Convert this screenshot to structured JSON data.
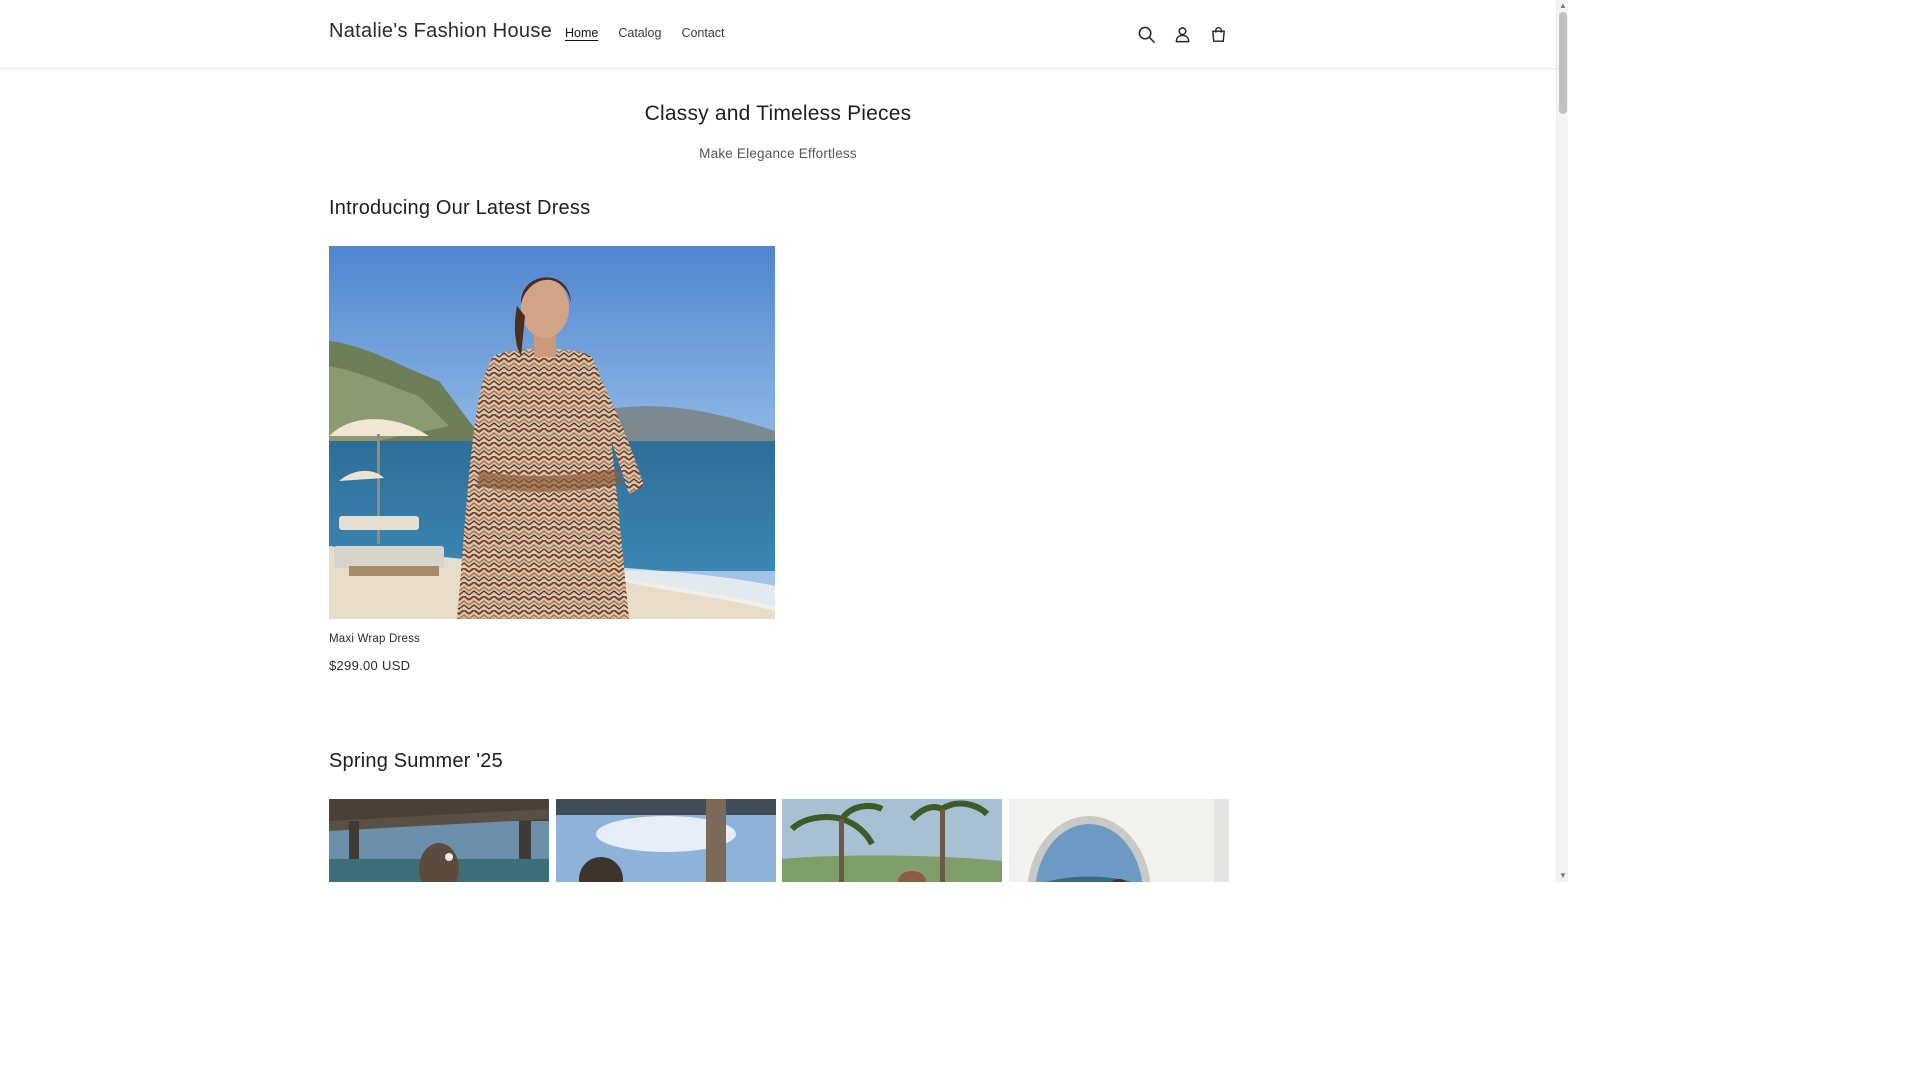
{
  "header": {
    "brand": "Natalie's Fashion House",
    "nav": [
      {
        "label": "Home",
        "active": true
      },
      {
        "label": "Catalog",
        "active": false
      },
      {
        "label": "Contact",
        "active": false
      }
    ],
    "icons": [
      "search-icon",
      "account-icon",
      "cart-icon"
    ]
  },
  "hero": {
    "title": "Classy and Timeless Pieces",
    "subtitle": "Make Elegance Effortless"
  },
  "featured": {
    "heading": "Introducing Our Latest Dress",
    "product": {
      "name": "Maxi Wrap Dress",
      "price": "$299.00 USD"
    }
  },
  "collection": {
    "heading": "Spring Summer '25",
    "items": 4
  },
  "colors": {
    "text": "#121212",
    "border": "#e8e8e8",
    "muted": "#555555"
  }
}
